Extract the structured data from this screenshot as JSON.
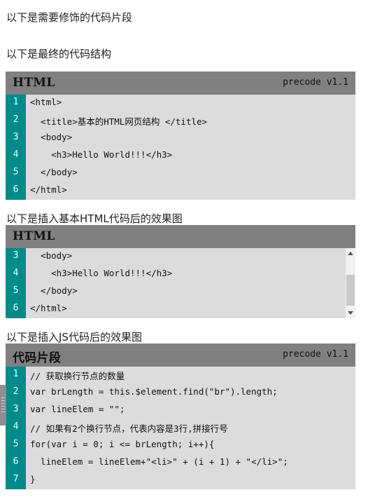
{
  "texts": {
    "intro1": "以下是需要修饰的代码片段",
    "intro2": "以下是最终的代码结构",
    "intro3": "以下是插入基本HTML代码后的效果图",
    "intro4": "以下是插入JS代码后的效果图"
  },
  "block1": {
    "lang": "HTML",
    "version": "precode v1.1",
    "lines": [
      {
        "n": "1",
        "code": "<html>"
      },
      {
        "n": "2",
        "code": "  <title>基本的HTML网页结构 </title>"
      },
      {
        "n": "3",
        "code": "  <body>"
      },
      {
        "n": "4",
        "code": "    <h3>Hello World!!!</h3>"
      },
      {
        "n": "5",
        "code": "  </body>"
      },
      {
        "n": "6",
        "code": "</html>"
      }
    ]
  },
  "block2": {
    "lang": "HTML",
    "lines": [
      {
        "n": "3",
        "code": "  <body>"
      },
      {
        "n": "4",
        "code": "    <h3>Hello World!!!</h3>"
      },
      {
        "n": "5",
        "code": "  </body>"
      },
      {
        "n": "6",
        "code": "</html>"
      }
    ]
  },
  "block3": {
    "lang": "代码片段",
    "version": "precode v1.1",
    "lines": [
      {
        "n": "1",
        "code": "// 获取换行节点的数量"
      },
      {
        "n": "2",
        "code": "var brLength = this.$element.find(\"br\").length;"
      },
      {
        "n": "3",
        "code": "var lineElem = \"\";"
      },
      {
        "n": "4",
        "code": "// 如果有2个换行节点，代表内容是3行,拼接行号"
      },
      {
        "n": "5",
        "code": "for(var i = 0; i <= brLength; i++){"
      },
      {
        "n": "6",
        "code": "  lineElem = lineElem+\"<li>\" + (i + 1) + \"</li>\";"
      },
      {
        "n": "7",
        "code": "}"
      }
    ]
  },
  "colors": {
    "gutter": "#008b8b",
    "header": "#808080",
    "code_bg": "#dcdcdc"
  }
}
